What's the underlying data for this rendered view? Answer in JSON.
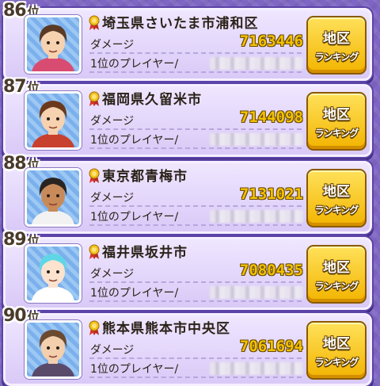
{
  "rows": [
    {
      "rank": "86",
      "rank_suffix": "位",
      "area": "埼玉県さいたま市浦和区",
      "damage_label": "ダメージ",
      "damage": "7163446",
      "player_label": "1位のプレイヤー/",
      "button_line1": "地区",
      "button_line2": "ランキング",
      "hair": "#5a3a24",
      "skin": "#f7d2b0",
      "shirt": "#d94c72"
    },
    {
      "rank": "87",
      "rank_suffix": "位",
      "area": "福岡県久留米市",
      "damage_label": "ダメージ",
      "damage": "7144098",
      "player_label": "1位のプレイヤー/",
      "button_line1": "地区",
      "button_line2": "ランキング",
      "hair": "#6b3a1c",
      "skin": "#f7d2b0",
      "shirt": "#c8402e"
    },
    {
      "rank": "88",
      "rank_suffix": "位",
      "area": "東京都青梅市",
      "damage_label": "ダメージ",
      "damage": "7131021",
      "player_label": "1位のプレイヤー/",
      "button_line1": "地区",
      "button_line2": "ランキング",
      "hair": "#2a2420",
      "skin": "#c98a5a",
      "shirt": "#f2f2f2"
    },
    {
      "rank": "89",
      "rank_suffix": "位",
      "area": "福井県坂井市",
      "damage_label": "ダメージ",
      "damage": "7080435",
      "player_label": "1位のプレイヤー/",
      "button_line1": "地区",
      "button_line2": "ランキング",
      "hair": "#5fd6e6",
      "skin": "#fbe3cf",
      "shirt": "#ffffff"
    },
    {
      "rank": "90",
      "rank_suffix": "位",
      "area": "熊本県熊本市中央区",
      "damage_label": "ダメージ",
      "damage": "7061694",
      "player_label": "1位のプレイヤー/",
      "button_line1": "地区",
      "button_line2": "ランキング",
      "hair": "#6b4a30",
      "skin": "#f3cfae",
      "shirt": "#5a4a6a"
    }
  ],
  "icons": {
    "medal": "medal-ribbon-icon",
    "avatar": "player-avatar"
  }
}
